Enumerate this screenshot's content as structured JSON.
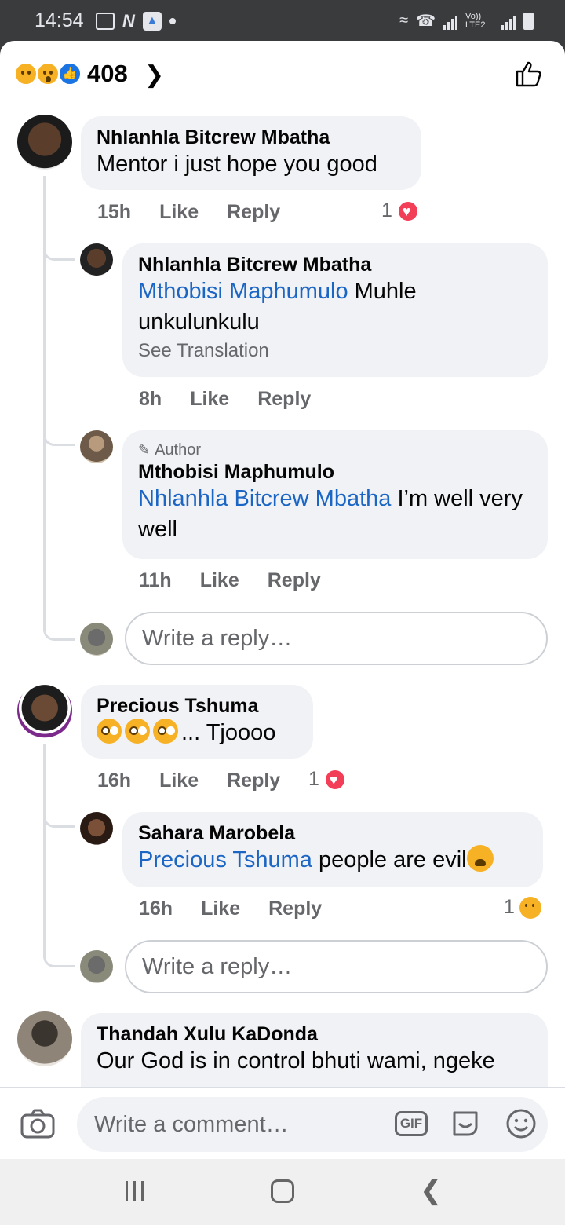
{
  "status_bar": {
    "time": "14:54",
    "network": "Vo)) LTE2"
  },
  "header": {
    "reaction_count": "408",
    "reaction_icons": [
      "sad-icon",
      "wow-icon",
      "like-icon"
    ]
  },
  "comments": [
    {
      "name": "Nhlanhla Bitcrew Mbatha",
      "text": "Mentor i just hope you good",
      "time": "15h",
      "like": "Like",
      "reply": "Reply",
      "reaction_count": "1",
      "reaction": "heart",
      "replies": [
        {
          "name": "Nhlanhla Bitcrew Mbatha",
          "mention": "Mthobisi Maphumulo",
          "text": "Muhle unkulunkulu",
          "see_translation": "See Translation",
          "time": "8h",
          "like": "Like",
          "reply": "Reply"
        },
        {
          "badge": "Author",
          "name": "Mthobisi Maphumulo",
          "mention": "Nhlanhla Bitcrew Mbatha",
          "text": "I’m well very well",
          "time": "11h",
          "like": "Like",
          "reply": "Reply"
        }
      ],
      "reply_placeholder": "Write a reply…"
    },
    {
      "name": "Precious Tshuma",
      "text": "... Tjoooo",
      "time": "16h",
      "like": "Like",
      "reply": "Reply",
      "reaction_count": "1",
      "reaction": "heart",
      "replies": [
        {
          "name": "Sahara Marobela",
          "mention": "Precious Tshuma",
          "text": "people are evil",
          "time": "16h",
          "like": "Like",
          "reply": "Reply",
          "reaction_count": "1",
          "reaction": "sad"
        }
      ],
      "reply_placeholder": "Write a reply…"
    },
    {
      "name": "Thandah Xulu KaDonda",
      "text": "Our God is in control bhuti wami, ngeke"
    }
  ],
  "composer": {
    "placeholder": "Write a comment…",
    "gif_label": "GIF"
  },
  "colors": {
    "mention": "#1b65c4",
    "bubble": "#f0f2f5",
    "muted": "#65676b",
    "heart": "#f33e58",
    "like_blue": "#1b74e4"
  }
}
